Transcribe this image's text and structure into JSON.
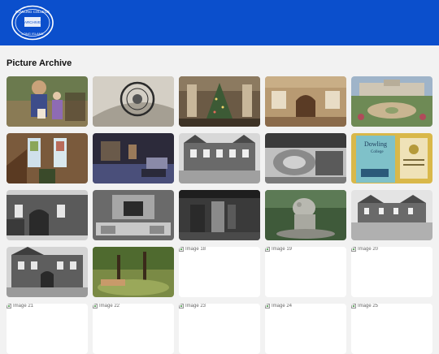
{
  "header": {
    "logo_top_text": "DOWLING COLLEGE",
    "logo_center_text": "ARCHIVE",
    "logo_bottom_text": "LONG ISLAND",
    "background": "#0b4fcc"
  },
  "page_title": "Picture Archive",
  "tiles": [
    {
      "alt": "",
      "broken": false
    },
    {
      "alt": "",
      "broken": false
    },
    {
      "alt": "",
      "broken": false
    },
    {
      "alt": "",
      "broken": false
    },
    {
      "alt": "",
      "broken": false
    },
    {
      "alt": "",
      "broken": false
    },
    {
      "alt": "",
      "broken": false
    },
    {
      "alt": "",
      "broken": false
    },
    {
      "alt": "",
      "broken": false
    },
    {
      "alt": "",
      "broken": false,
      "book_title": "Dowling",
      "book_subtitle": "College"
    },
    {
      "alt": "",
      "broken": false
    },
    {
      "alt": "",
      "broken": false
    },
    {
      "alt": "",
      "broken": false
    },
    {
      "alt": "",
      "broken": false
    },
    {
      "alt": "",
      "broken": false
    },
    {
      "alt": "",
      "broken": false
    },
    {
      "alt": "",
      "broken": false
    },
    {
      "alt": "Image 18",
      "broken": true
    },
    {
      "alt": "Image 19",
      "broken": true
    },
    {
      "alt": "Image 20",
      "broken": true
    },
    {
      "alt": "Image 21",
      "broken": true
    },
    {
      "alt": "Image 22",
      "broken": true
    },
    {
      "alt": "Image 23",
      "broken": true
    },
    {
      "alt": "Image 24",
      "broken": true
    },
    {
      "alt": "Image 25",
      "broken": true
    }
  ]
}
